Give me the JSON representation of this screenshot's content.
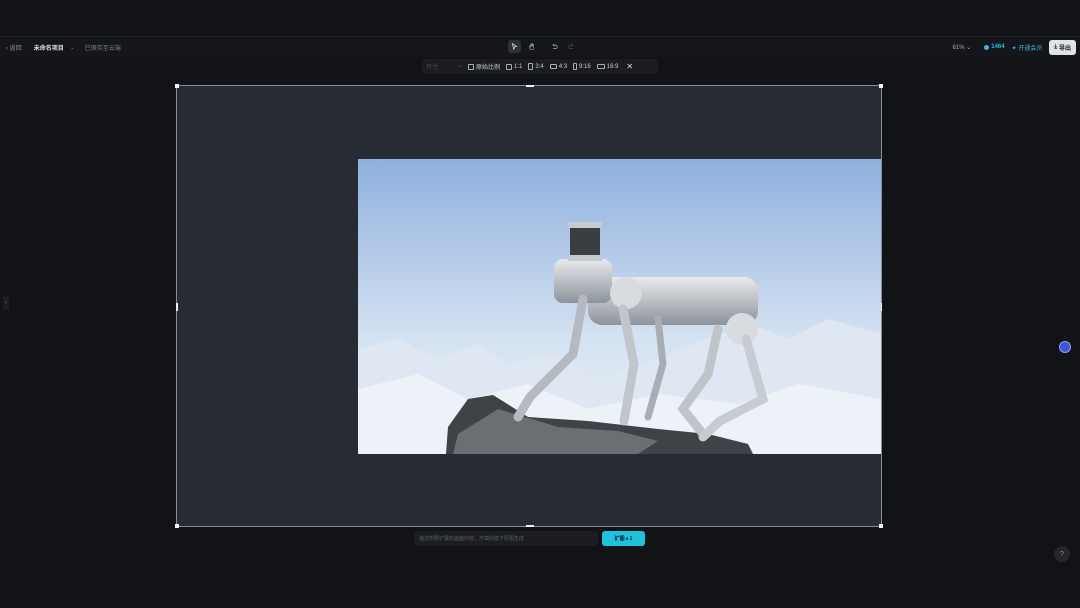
{
  "topbar": {
    "back_label": "返回",
    "project_title": "未命名项目",
    "save_status": "已保存至云端",
    "zoom_level": "61%",
    "credits": "1464",
    "member_label": "开通会员",
    "export_label": "导出"
  },
  "ratio_bar": {
    "select_placeholder": "尺寸",
    "original_label": "原始比例",
    "options": [
      "1:1",
      "3:4",
      "4:3",
      "9:16",
      "16:9"
    ]
  },
  "prompt": {
    "placeholder": "描述想要扩展的画面内容，不填则基于原图生成",
    "button_label": "扩图",
    "button_cost": "1"
  },
  "colors": {
    "accent": "#1fc2dc",
    "canvas_bg": "#272b33",
    "app_bg": "#121317"
  },
  "icons": {
    "select_tool": "cursor-icon",
    "hand_tool": "hand-icon",
    "undo": "undo-icon",
    "redo": "redo-icon",
    "close": "close-icon",
    "assistant": "assistant-icon",
    "help": "help-icon"
  }
}
